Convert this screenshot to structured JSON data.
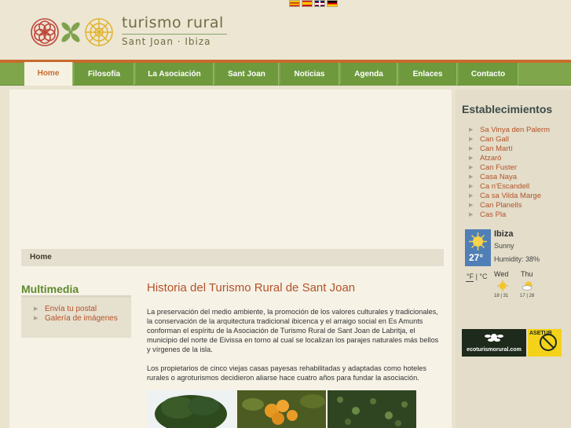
{
  "header": {
    "logo_title": "turismo rural",
    "logo_subtitle": "Sant Joan · Ibiza",
    "flags": [
      "catalan-flag-icon",
      "spanish-flag-icon",
      "english-flag-icon",
      "german-flag-icon"
    ]
  },
  "nav": {
    "items": [
      {
        "label": "Home",
        "active": true
      },
      {
        "label": "Filosofía"
      },
      {
        "label": "La Asociación"
      },
      {
        "label": "Sant Joan"
      },
      {
        "label": "Noticias"
      },
      {
        "label": "Agenda"
      },
      {
        "label": "Enlaces"
      },
      {
        "label": "Contacto"
      }
    ]
  },
  "breadcrumb": "Home",
  "multimedia": {
    "title": "Multimedia",
    "items": [
      "Envía tu postal",
      "Galería de imágenes"
    ]
  },
  "article": {
    "title": "Historia del Turismo Rural de Sant Joan",
    "p1": "La preservación del medio ambiente, la promoción de los valores culturales y tradicionales, la conservación de la arquitectura tradicional ibicenca y el arraigo social en Es Amunts conforman el espíritu de la Asociación de Turismo Rural de Sant Joan de Labritja, el municipio del norte de Eivissa en torno al cual se localizan los parajes naturales más bellos y vírgenes de la isla.",
    "p2": "Los propietarios de cinco viejas casas payesas rehabilitadas y adaptadas como hoteles rurales o agroturismos decidieron aliarse hace cuatro años para fundar la asociación."
  },
  "sidebar": {
    "title": "Establecimientos",
    "items": [
      "Sa Vinya den Palerm",
      "Can Gall",
      "Can Martí",
      "Atzaró",
      "Can Fuster",
      "Casa Naya",
      "Ca n'Escandell",
      "Ca sa Vilda Marge",
      "Can Planells",
      "Cas Pla"
    ]
  },
  "weather": {
    "city": "Ibiza",
    "condition": "Sunny",
    "humidity": "Humidity: 38%",
    "temperature": "27°",
    "units": "°F | °C",
    "forecast": [
      {
        "day": "Wed",
        "temps": "18 | 31",
        "icon": "sun-icon"
      },
      {
        "day": "Thu",
        "temps": "17 | 28",
        "icon": "partly-cloudy-icon"
      }
    ]
  },
  "badges": {
    "eco": "ecoturismorural.com",
    "asetur": "ASETUR"
  }
}
